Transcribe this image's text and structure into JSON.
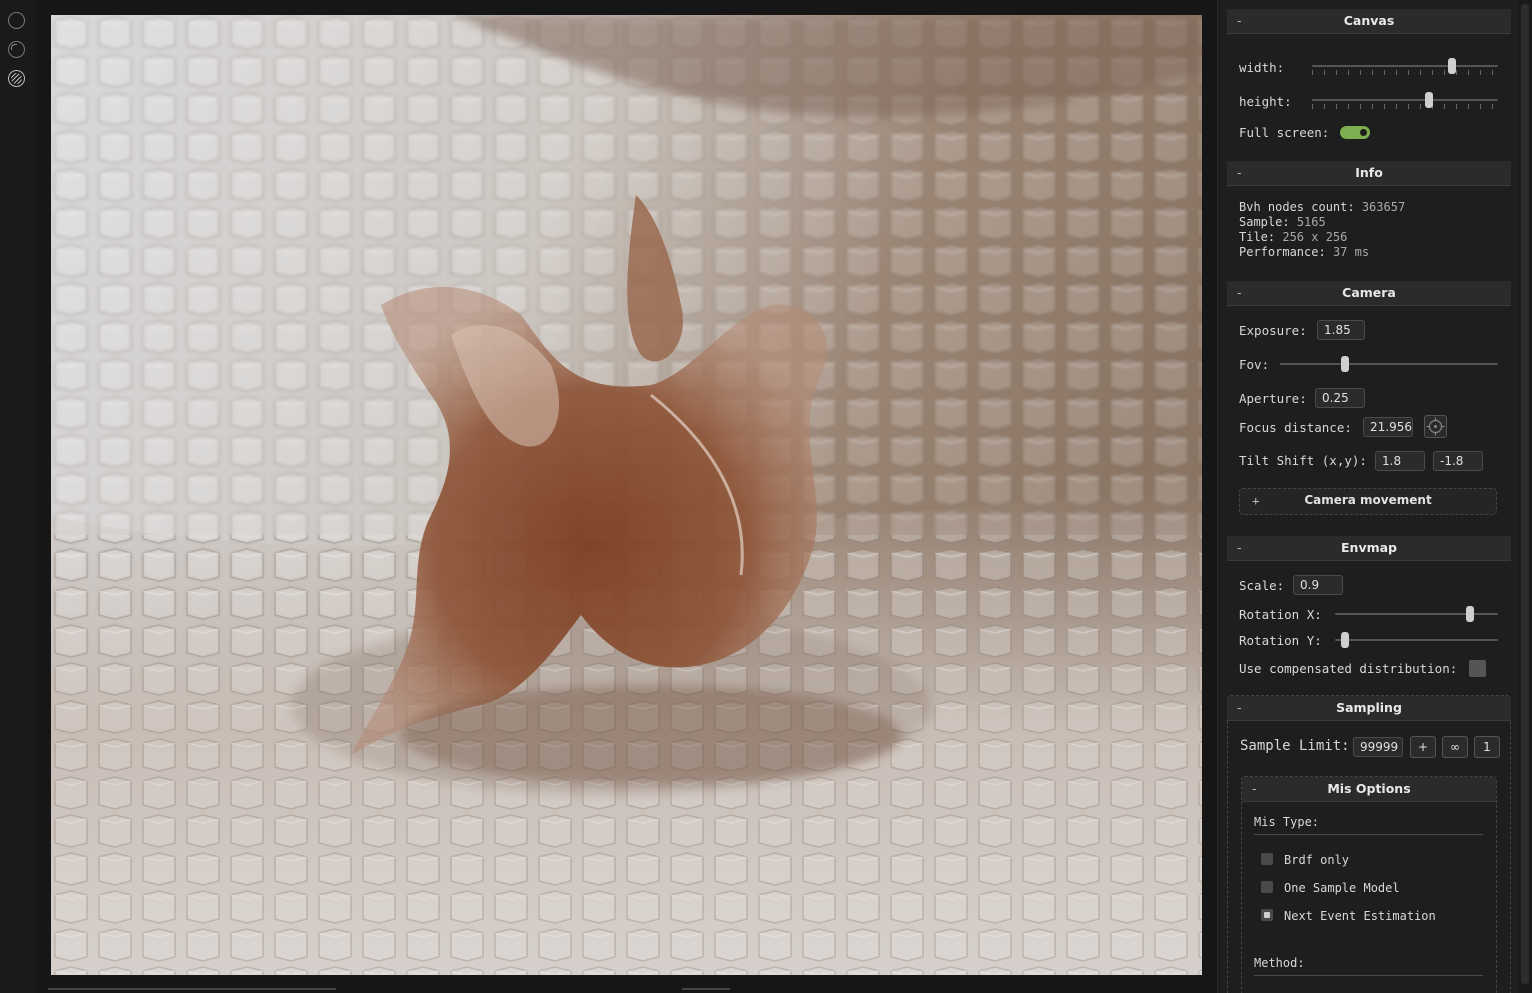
{
  "toolbar": {
    "icons": [
      "circle-icon",
      "circle-half-icon",
      "render-mode-icon"
    ]
  },
  "viewport": {
    "alt": "Path-traced render: glass horse sculpture on hexagonal pillars"
  },
  "canvas": {
    "title": "Canvas",
    "toggle": "-",
    "width_label": "width:",
    "width_level": 0.75,
    "height_label": "height:",
    "height_level": 0.63,
    "fullscreen_label": "Full screen:",
    "fullscreen_on": true
  },
  "info": {
    "title": "Info",
    "toggle": "-",
    "bvh_label": "Bvh nodes count:",
    "bvh_value": "363657",
    "sample_label": "Sample:",
    "sample_value": "5165",
    "tile_label": "Tile:",
    "tile_value": "256 x 256",
    "perf_label": "Performance:",
    "perf_value": "37 ms"
  },
  "camera": {
    "title": "Camera",
    "toggle": "-",
    "exposure_label": "Exposure:",
    "exposure_value": "1.85",
    "fov_label": "Fov:",
    "fov_level": 0.3,
    "aperture_label": "Aperture:",
    "aperture_value": "0.25",
    "focus_label": "Focus distance:",
    "focus_value": "21.956",
    "tilt_label": "Tilt Shift (x,y):",
    "tilt_x": "1.8",
    "tilt_y": "-1.8",
    "movement_toggle": "+",
    "movement_label": "Camera movement"
  },
  "envmap": {
    "title": "Envmap",
    "toggle": "-",
    "scale_label": "Scale:",
    "scale_value": "0.9",
    "rotx_label": "Rotation X:",
    "rotx_level": 0.83,
    "roty_label": "Rotation Y:",
    "roty_level": 0.06,
    "compensated_label": "Use compensated distribution:",
    "compensated_on": false
  },
  "sampling": {
    "title": "Sampling",
    "toggle": "-",
    "limit_label": "Sample Limit:",
    "limit_value": "99999",
    "btn_plus": "+",
    "btn_inf": "∞",
    "btn_one": "1",
    "mis": {
      "title": "Mis Options",
      "toggle": "-",
      "type_label": "Mis Type:",
      "options": [
        {
          "label": "Brdf only",
          "selected": false
        },
        {
          "label": "One Sample Model",
          "selected": false
        },
        {
          "label": "Next Event Estimation",
          "selected": true
        }
      ],
      "method_label": "Method:"
    }
  },
  "colors": {
    "accent_green": "#7caf4f",
    "panel_bg": "#1e1e1e",
    "header_bg": "#2b2b2b"
  }
}
